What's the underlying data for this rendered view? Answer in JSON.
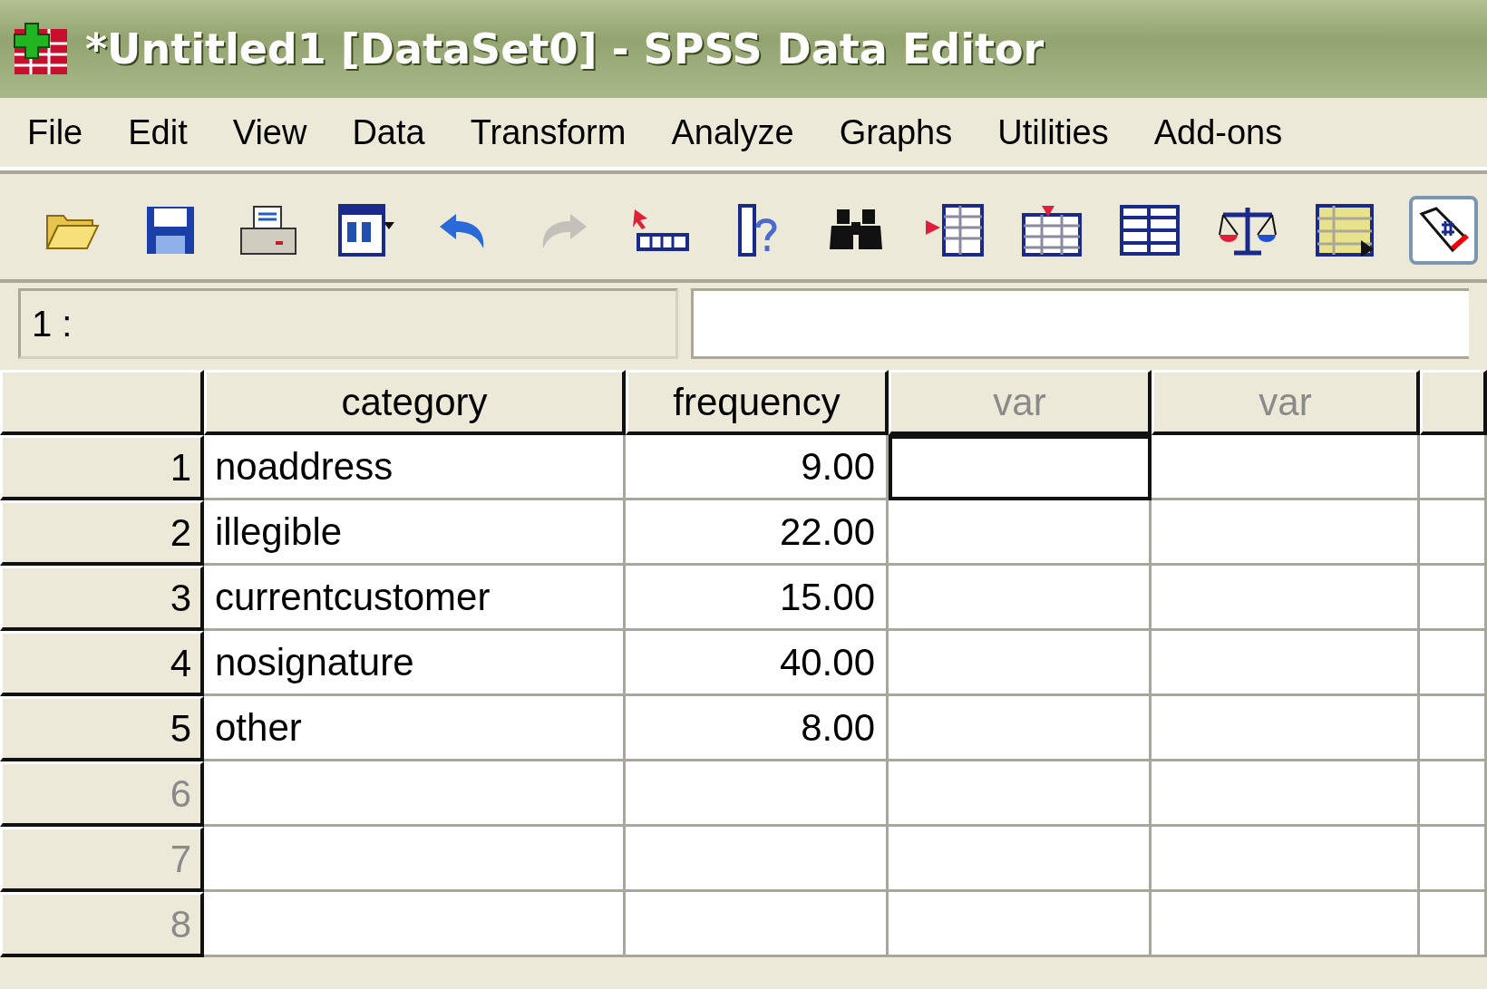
{
  "window": {
    "title": "*Untitled1 [DataSet0] - SPSS Data Editor"
  },
  "menu": [
    "File",
    "Edit",
    "View",
    "Data",
    "Transform",
    "Analyze",
    "Graphs",
    "Utilities",
    "Add-ons"
  ],
  "toolbar": [
    {
      "kind": "open",
      "disabled": false,
      "on": false
    },
    {
      "kind": "save",
      "disabled": false,
      "on": false
    },
    {
      "kind": "print",
      "disabled": false,
      "on": false
    },
    {
      "kind": "recall",
      "disabled": false,
      "on": false
    },
    {
      "kind": "undo",
      "disabled": false,
      "on": false
    },
    {
      "kind": "redo",
      "disabled": true,
      "on": false
    },
    {
      "kind": "goto",
      "disabled": false,
      "on": false
    },
    {
      "kind": "variables",
      "disabled": false,
      "on": false
    },
    {
      "kind": "find",
      "disabled": false,
      "on": false
    },
    {
      "kind": "insert_case",
      "disabled": false,
      "on": false
    },
    {
      "kind": "insert_variable",
      "disabled": false,
      "on": false
    },
    {
      "kind": "split",
      "disabled": false,
      "on": false
    },
    {
      "kind": "weight",
      "disabled": false,
      "on": false
    },
    {
      "kind": "select",
      "disabled": false,
      "on": false
    },
    {
      "kind": "labels",
      "disabled": false,
      "on": true
    }
  ],
  "cell_ref": "1 :",
  "columns": [
    {
      "label": "category",
      "kind": "defined"
    },
    {
      "label": "frequency",
      "kind": "defined"
    },
    {
      "label": "var",
      "kind": "empty"
    },
    {
      "label": "var",
      "kind": "empty"
    }
  ],
  "rows": [
    {
      "number": "1",
      "empty": false,
      "cells": [
        {
          "text": "noaddress",
          "selected": false
        },
        {
          "text": "9.00",
          "selected": false
        },
        {
          "selected": true
        },
        {
          "selected": false
        }
      ]
    },
    {
      "number": "2",
      "empty": false,
      "cells": [
        {
          "text": "illegible",
          "selected": false
        },
        {
          "text": "22.00",
          "selected": false
        },
        {
          "selected": false
        },
        {
          "selected": false
        }
      ]
    },
    {
      "number": "3",
      "empty": false,
      "cells": [
        {
          "text": "currentcustomer",
          "selected": false
        },
        {
          "text": "15.00",
          "selected": false
        },
        {
          "selected": false
        },
        {
          "selected": false
        }
      ]
    },
    {
      "number": "4",
      "empty": false,
      "cells": [
        {
          "text": "nosignature",
          "selected": false
        },
        {
          "text": "40.00",
          "selected": false
        },
        {
          "selected": false
        },
        {
          "selected": false
        }
      ]
    },
    {
      "number": "5",
      "empty": false,
      "cells": [
        {
          "text": "other",
          "selected": false
        },
        {
          "text": "8.00",
          "selected": false
        },
        {
          "selected": false
        },
        {
          "selected": false
        }
      ]
    },
    {
      "number": "6",
      "empty": true,
      "cells": [
        {
          "selected": false
        },
        {
          "selected": false
        },
        {
          "selected": false
        },
        {
          "selected": false
        }
      ]
    },
    {
      "number": "7",
      "empty": true,
      "cells": [
        {
          "selected": false
        },
        {
          "selected": false
        },
        {
          "selected": false
        },
        {
          "selected": false
        }
      ]
    },
    {
      "number": "8",
      "empty": true,
      "cells": [
        {
          "selected": false
        },
        {
          "selected": false
        },
        {
          "selected": false
        },
        {
          "selected": false
        }
      ]
    }
  ]
}
